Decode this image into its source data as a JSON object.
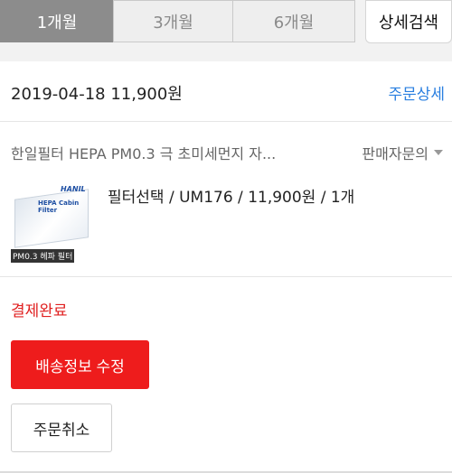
{
  "period_tabs": [
    {
      "label": "1개월",
      "active": true
    },
    {
      "label": "3개월",
      "active": false
    },
    {
      "label": "6개월",
      "active": false
    }
  ],
  "detail_search_label": "상세검색",
  "order": {
    "date_amount": "2019-04-18  11,900원",
    "detail_link": "주문상세",
    "product_name": "한일필터 HEPA PM0.3 극 초미세먼지 자...",
    "seller_inquiry": "판매자문의",
    "thumbnail": {
      "brand": "HANIL",
      "product_text": "HEPA Cabin Filter",
      "caption": "PM0.3 헤파 필터"
    },
    "option": "필터선택 / UM176 / 11,900원 / 1개",
    "status": "결제완료",
    "edit_shipping_button": "배송정보 수정",
    "cancel_order_button": "주문취소"
  },
  "colors": {
    "accent_red": "#ee1c1c",
    "link_blue": "#2a7fe0",
    "active_tab": "#8c8c8c"
  }
}
